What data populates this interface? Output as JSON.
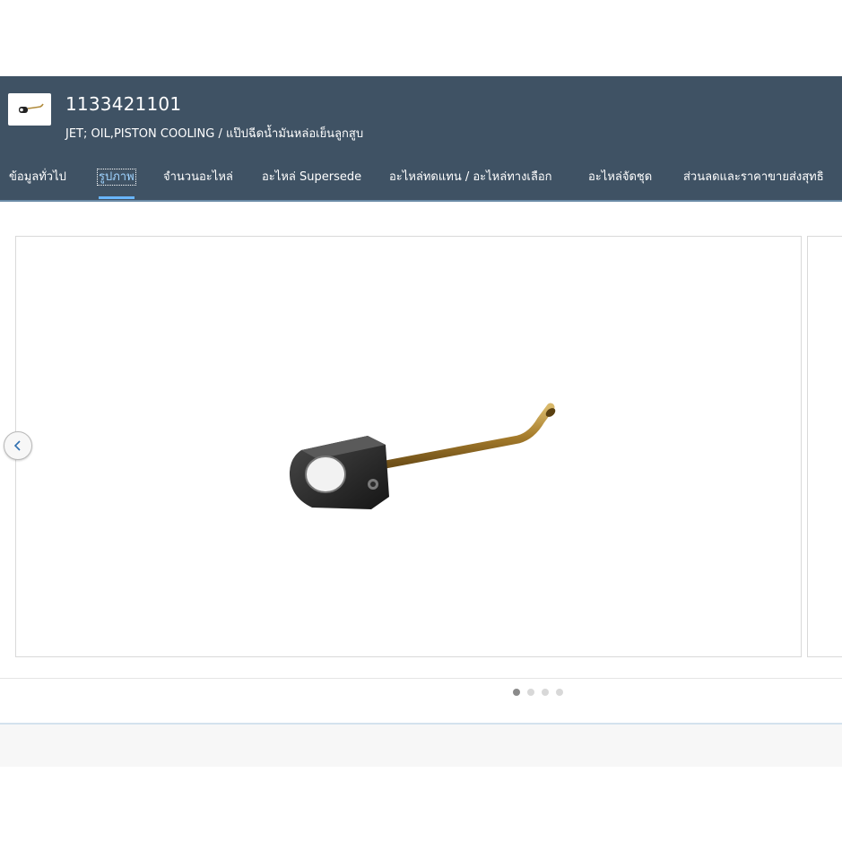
{
  "header": {
    "part_number": "1133421101",
    "description": "JET; OIL,PISTON COOLING / แป๊ปฉีดน้ำมันหล่อเย็นลูกสูบ",
    "background_color": "#3f5264"
  },
  "tabs": [
    {
      "label": "ข้อมูลทั่วไป",
      "active": false
    },
    {
      "label": "รูปภาพ",
      "active": true
    },
    {
      "label": "จำนวนอะไหล่",
      "active": false
    },
    {
      "label": "อะไหล่ Supersede",
      "active": false
    },
    {
      "label": "อะไหล่ทดแทน / อะไหล่ทางเลือก",
      "active": false
    },
    {
      "label": "อะไหล่จัดชุด",
      "active": false
    },
    {
      "label": "ส่วนลดและราคาขายส่งสุทธิ",
      "active": false
    }
  ],
  "carousel": {
    "image_subject": "oil-piston-cooling-jet",
    "prev_icon": "chevron-left-icon",
    "page_count": 4,
    "current_page": 1
  },
  "accent_color": "#69b6ff"
}
